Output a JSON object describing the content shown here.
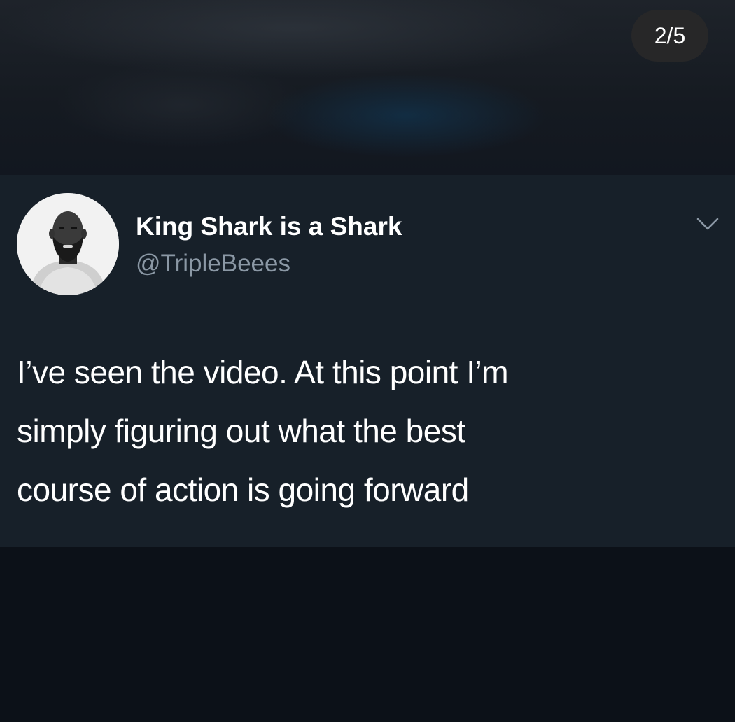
{
  "story": {
    "counter": "2/5"
  },
  "tweet": {
    "display_name": "King Shark is a Shark",
    "handle": "@TripleBeees",
    "text_lines": [
      "I’ve seen the video. At this point I’m",
      "simply figuring out what the best",
      "course of action is going forward"
    ],
    "menu_icon": "chevron-down-icon",
    "avatar_icon": "profile-photo"
  },
  "colors": {
    "card_background": "#172029",
    "page_background": "#0e121a",
    "text_primary": "#ffffff",
    "text_secondary": "#8b98a5",
    "badge_background": "#282828"
  }
}
